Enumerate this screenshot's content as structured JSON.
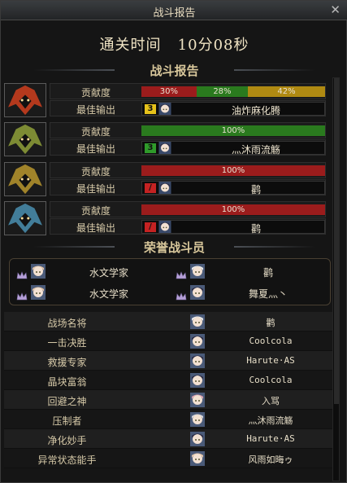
{
  "window": {
    "title": "战斗报告",
    "close_glyph": "✕"
  },
  "clear_time": {
    "label": "通关时间",
    "value": "10分08秒"
  },
  "battle_report": {
    "header": "战斗报告",
    "contribution_label": "贡献度",
    "best_output_label": "最佳输出",
    "players": [
      {
        "portrait_color": "#d0401e",
        "segments": [
          {
            "label": "30%",
            "pct": 30,
            "color": "#9b1c1c"
          },
          {
            "label": "28%",
            "pct": 28,
            "color": "#2a7a1e"
          },
          {
            "label": "42%",
            "pct": 42,
            "color": "#b08a12"
          }
        ],
        "rank": "3",
        "rank_color": "#e6c21a",
        "name": "油炸麻化腾"
      },
      {
        "portrait_color": "#8fa03a",
        "segments": [
          {
            "label": "100%",
            "pct": 100,
            "color": "#2a7a1e"
          }
        ],
        "rank": "3",
        "rank_color": "#2f9a2a",
        "name": "灬沐雨流觞"
      },
      {
        "portrait_color": "#b8962e",
        "segments": [
          {
            "label": "100%",
            "pct": 100,
            "color": "#9b1c1c"
          }
        ],
        "rank": "/",
        "rank_color": "#c42222",
        "name": "鹳"
      },
      {
        "portrait_color": "#4a8fb0",
        "segments": [
          {
            "label": "100%",
            "pct": 100,
            "color": "#9b1c1c"
          }
        ],
        "rank": "/",
        "rank_color": "#c42222",
        "name": "鹳"
      }
    ]
  },
  "honor": {
    "header": "荣誉战斗员",
    "members": [
      {
        "name": "水文学家"
      },
      {
        "name": "鹳"
      },
      {
        "name": "水文学家"
      },
      {
        "name": "舞夏灬丶"
      }
    ]
  },
  "awards": [
    {
      "title": "战场名将",
      "player": "鹳"
    },
    {
      "title": "一击决胜",
      "player": "Coolcola"
    },
    {
      "title": "救援专家",
      "player": "Harute·AS"
    },
    {
      "title": "晶块富翁",
      "player": "Coolcola"
    },
    {
      "title": "回避之神",
      "player": "入骂"
    },
    {
      "title": "压制者",
      "player": "灬沐雨流觞"
    },
    {
      "title": "净化妙手",
      "player": "Harute·AS"
    },
    {
      "title": "异常状态能手",
      "player": "风雨如晦ゥ"
    }
  ]
}
